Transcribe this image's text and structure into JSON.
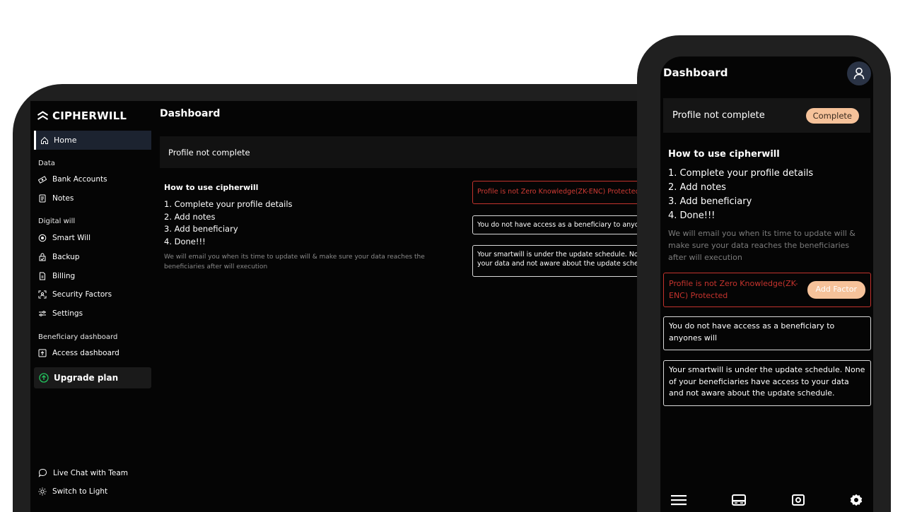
{
  "desktop": {
    "brand": "CIPHERWILL",
    "title": "Dashboard",
    "nav": {
      "home": "Home",
      "section_data": "Data",
      "bank_accounts": "Bank Accounts",
      "notes": "Notes",
      "section_digital_will": "Digital will",
      "smart_will": "Smart Will",
      "backup": "Backup",
      "billing": "Billing",
      "security_factors": "Security Factors",
      "settings": "Settings",
      "section_beneficiary": "Beneficiary dashboard",
      "access_dashboard": "Access dashboard",
      "upgrade_plan": "Upgrade plan",
      "live_chat": "Live Chat with Team",
      "switch_theme": "Switch to Light"
    },
    "profile_banner": "Profile not complete",
    "how_to": {
      "title": "How to use cipherwill",
      "steps": [
        "1. Complete your profile details",
        "2. Add notes",
        "3. Add beneficiary",
        "4. Done!!!"
      ],
      "note": "We will email you when its time to update will & make sure your data reaches the beneficiaries after will execution"
    },
    "cards": {
      "zk_warning": "Profile is not Zero Knowledge(ZK-ENC) Protected",
      "beneficiary_access": "You do not have access as a beneficiary to anyones will",
      "schedule_line1": "Your smartwill is under the update schedule. None of your beneficiaries have access to",
      "schedule_line2": "your data and not aware about the update schedule."
    }
  },
  "mobile": {
    "title": "Dashboard",
    "profile_banner": "Profile not complete",
    "complete_button": "Complete",
    "how_to": {
      "title": "How to use cipherwill",
      "steps": [
        "1. Complete your profile details",
        "2. Add notes",
        "3. Add beneficiary",
        "4. Done!!!"
      ],
      "note": "We will email you when its time to update will & make sure your data reaches the beneficiaries after will execution"
    },
    "cards": {
      "zk_warning": "Profile is not Zero Knowledge(ZK-ENC) Protected",
      "add_factor_button": "Add Factor",
      "beneficiary_access": "You do not have access as a beneficiary to anyones will",
      "schedule": "Your smartwill is under the update schedule. None of your beneficiaries have access to your data and not aware about the update schedule."
    },
    "tabbar_icons": [
      "menu-icon",
      "card-icon",
      "vault-icon",
      "settings-gear-icon"
    ]
  },
  "colors": {
    "screen_bg": "#050505",
    "frame": "#1f1f1f",
    "accent_pill": "#f6c29a",
    "danger": "#c3332d",
    "upgrade_green": "#22c55e",
    "muted_text": "#8a8a8a"
  }
}
